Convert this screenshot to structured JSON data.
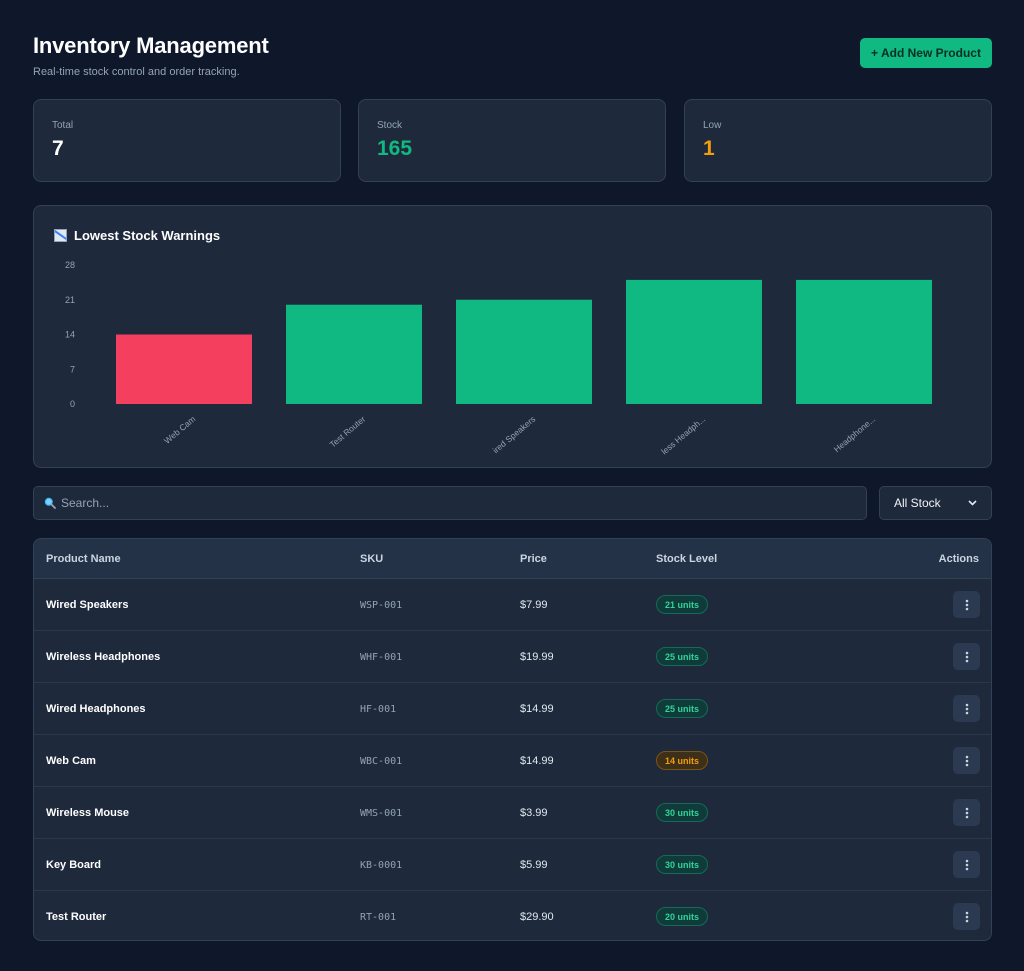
{
  "header": {
    "title": "Inventory Management",
    "subtitle": "Real-time stock control and order tracking.",
    "add_button_label": "+ Add New Product"
  },
  "stats": [
    {
      "label": "Total",
      "value": "7",
      "color": "#ffffff"
    },
    {
      "label": "Stock",
      "value": "165",
      "color": "#10b981"
    },
    {
      "label": "Low",
      "value": "1",
      "color": "#f59e0b"
    }
  ],
  "chart_data": {
    "type": "bar",
    "title": "Lowest Stock Warnings",
    "icon": "chart-icon",
    "categories": [
      "Web Cam",
      "Test Router",
      "Wired Speakers",
      "Wireless Headphones",
      "Wired Headphones"
    ],
    "category_labels": [
      "Web Cam",
      "Test Router",
      "ired Speakers",
      "less Headph...",
      "Headphone..."
    ],
    "values": [
      14,
      20,
      21,
      25,
      25
    ],
    "bar_colors": [
      "#f43f5e",
      "#10b981",
      "#10b981",
      "#10b981",
      "#10b981"
    ],
    "yticks": [
      0,
      7,
      14,
      21,
      28
    ],
    "ylim": [
      0,
      28
    ],
    "grid": false,
    "legend": "none"
  },
  "search": {
    "placeholder": "Search...",
    "icon": "search-icon"
  },
  "filter": {
    "selected": "All Stock",
    "icon": "chevron-down-icon"
  },
  "table": {
    "headers": {
      "name": "Product Name",
      "sku": "SKU",
      "price": "Price",
      "stock": "Stock Level",
      "actions": "Actions"
    },
    "rows": [
      {
        "name": "Wired Speakers",
        "sku": "WSP-001",
        "price": "$7.99",
        "stock": "21 units",
        "status": "ok"
      },
      {
        "name": "Wireless Headphones",
        "sku": "WHF-001",
        "price": "$19.99",
        "stock": "25 units",
        "status": "ok"
      },
      {
        "name": "Wired Headphones",
        "sku": "HF-001",
        "price": "$14.99",
        "stock": "25 units",
        "status": "ok"
      },
      {
        "name": "Web Cam",
        "sku": "WBC-001",
        "price": "$14.99",
        "stock": "14 units",
        "status": "low"
      },
      {
        "name": "Wireless Mouse",
        "sku": "WMS-001",
        "price": "$3.99",
        "stock": "30 units",
        "status": "ok"
      },
      {
        "name": "Key Board",
        "sku": "KB-0001",
        "price": "$5.99",
        "stock": "30 units",
        "status": "ok"
      },
      {
        "name": "Test Router",
        "sku": "RT-001",
        "price": "$29.90",
        "stock": "20 units",
        "status": "ok"
      }
    ],
    "action_icon": "more-vertical-icon"
  },
  "colors": {
    "background": "#0f172a",
    "card": "#1e293b",
    "accent": "#10b981",
    "warning": "#f59e0b",
    "danger": "#f43f5e"
  }
}
